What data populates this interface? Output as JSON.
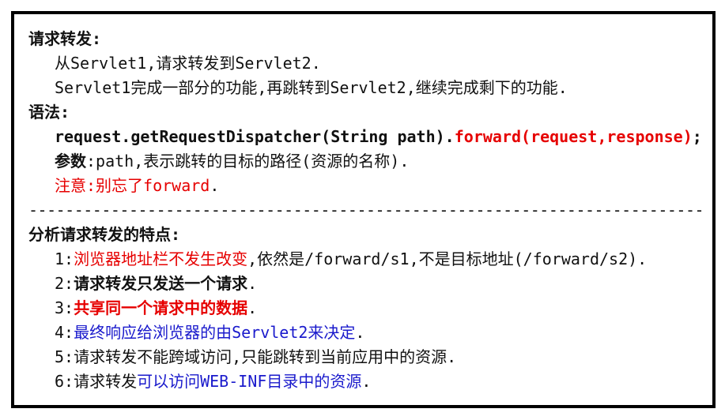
{
  "section1": {
    "heading": "请求转发:",
    "line1": "从Servlet1,请求转发到Servlet2.",
    "line2": "Servlet1完成一部分的功能,再跳转到Servlet2,继续完成剩下的功能."
  },
  "section2": {
    "heading": "语法:",
    "syntax_prefix": "request.getRequestDispatcher(String path).",
    "syntax_forward": "forward(request,response)",
    "syntax_suffix": ";",
    "param_label": "参数",
    "param_text": ":path,表示跳转的目标的路径(资源的名称).",
    "note": "注意:别忘了forward",
    "note_suffix": "."
  },
  "divider": "----------------------------------------------------------------------------",
  "section3": {
    "heading": "分析请求转发的特点:",
    "items": [
      {
        "num": "1:",
        "highlight": "浏览器地址栏不发生改变",
        "rest": ",依然是/forward/s1,不是目标地址(/forward/s2)."
      },
      {
        "num": "2:",
        "highlight": "请求转发只发送一个请求",
        "rest": "."
      },
      {
        "num": "3:",
        "highlight": "共享同一个请求中的数据",
        "rest": "."
      },
      {
        "num": "4:",
        "highlight": "最终响应给浏览器的由Servlet2来决定",
        "rest": "."
      },
      {
        "num": "5:",
        "text": "请求转发不能跨域访问,只能跳转到当前应用中的资源."
      },
      {
        "num": "6:",
        "prefix": "请求转发",
        "highlight": "可以访问WEB-INF目录中的资源",
        "rest": "."
      }
    ]
  },
  "colors": {
    "red": "#e60000",
    "blue": "#1a1acc",
    "text": "#111111",
    "border": "#000000"
  }
}
